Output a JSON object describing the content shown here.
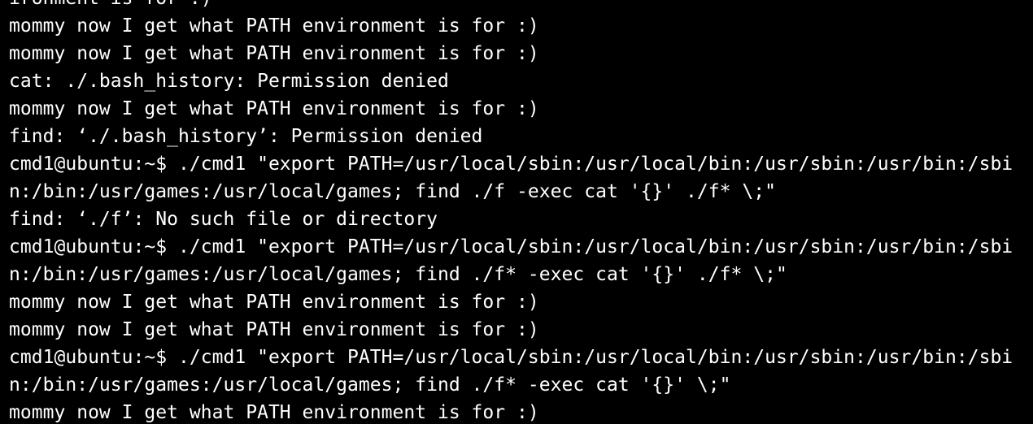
{
  "terminal": {
    "background": "#000000",
    "foreground": "#ffffff",
    "lines": [
      "ironment is for :)",
      "mommy now I get what PATH environment is for :)",
      "mommy now I get what PATH environment is for :)",
      "cat: ./.bash_history: Permission denied",
      "mommy now I get what PATH environment is for :)",
      "find: ‘./.bash_history’: Permission denied",
      "cmd1@ubuntu:~$ ./cmd1 \"export PATH=/usr/local/sbin:/usr/local/bin:/usr/sbin:/usr/bin:/sbi",
      "n:/bin:/usr/games:/usr/local/games; find ./f -exec cat '{}' ./f* \\;\"",
      "find: ‘./f’: No such file or directory",
      "cmd1@ubuntu:~$ ./cmd1 \"export PATH=/usr/local/sbin:/usr/local/bin:/usr/sbin:/usr/bin:/sbi",
      "n:/bin:/usr/games:/usr/local/games; find ./f* -exec cat '{}' ./f* \\;\"",
      "mommy now I get what PATH environment is for :)",
      "mommy now I get what PATH environment is for :)",
      "cmd1@ubuntu:~$ ./cmd1 \"export PATH=/usr/local/sbin:/usr/local/bin:/usr/sbin:/usr/bin:/sbi",
      "n:/bin:/usr/games:/usr/local/games; find ./f* -exec cat '{}' \\;\"",
      "mommy now I get what PATH environment is for :)"
    ]
  }
}
